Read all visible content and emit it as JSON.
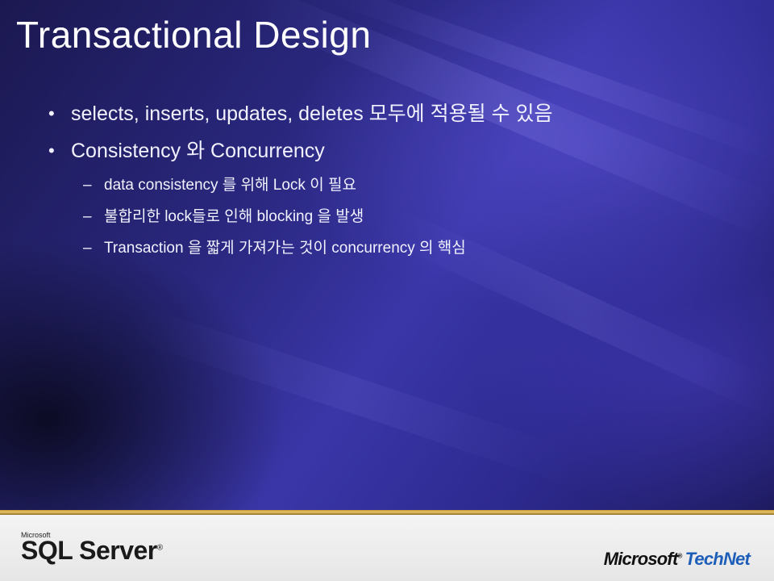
{
  "slide": {
    "title": "Transactional Design",
    "bullets": [
      "selects, inserts, updates, deletes 모두에 적용될 수 있음",
      "Consistency 와 Concurrency"
    ],
    "sub_bullets": [
      "data consistency 를 위해 Lock 이 필요",
      "불합리한 lock들로 인해 blocking 을 발생",
      "Transaction 을 짧게 가져가는 것이 concurrency 의 핵심"
    ],
    "bullet_glyph": "•",
    "dash_glyph": "–"
  },
  "footer": {
    "sql_small": "Microsoft",
    "sql_name": "SQL Server",
    "sql_tm": "®",
    "technet_ms": "Microsoft",
    "technet_tm": "®",
    "technet_name": "TechNet"
  },
  "colors": {
    "background": "#2a2880",
    "text": "#f2f2ff",
    "accent_gold": "#e8c468",
    "technet_blue": "#1d5fb8"
  }
}
